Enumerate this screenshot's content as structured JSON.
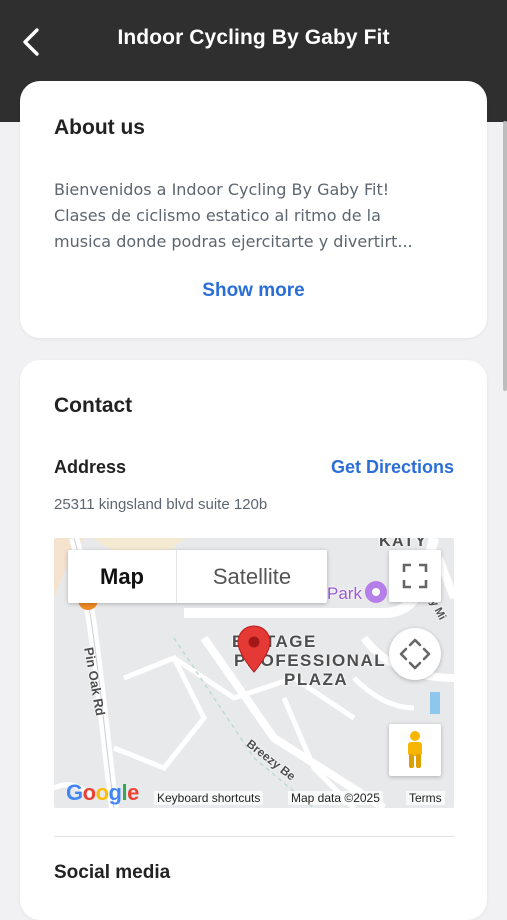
{
  "header": {
    "title": "Indoor Cycling By Gaby Fit",
    "back_icon": "chevron-left-icon"
  },
  "about": {
    "title": "About us",
    "lines": [
      "Bienvenidos a Indoor Cycling By Gaby Fit!",
      "Clases de ciclismo estatico al ritmo de la",
      "musica donde podras ejercitarte y divertirt..."
    ],
    "show_more": "Show more"
  },
  "contact": {
    "title": "Contact",
    "address_label": "Address",
    "get_directions": "Get Directions",
    "address_value": "25311 kingsland blvd suite 120b",
    "map": {
      "tab_map": "Map",
      "tab_satellite": "Satellite",
      "place_line1": "ERITAGE",
      "place_line2": "PROFESSIONAL",
      "place_line3": "PLAZA",
      "road_pin_oak": "Pin Oak Rd",
      "road_breezy": "Breezy Be",
      "road_katy": "KATY",
      "road_katy_mills": "Katy Mi",
      "park_label": "Park",
      "google": "Google",
      "keyboard_shortcuts": "Keyboard shortcuts",
      "map_data": "Map data ©2025",
      "terms": "Terms"
    }
  },
  "social": {
    "title": "Social media"
  },
  "colors": {
    "header_bg": "#2f2f2f",
    "link": "#2b6fd6",
    "pin": "#e53935"
  }
}
